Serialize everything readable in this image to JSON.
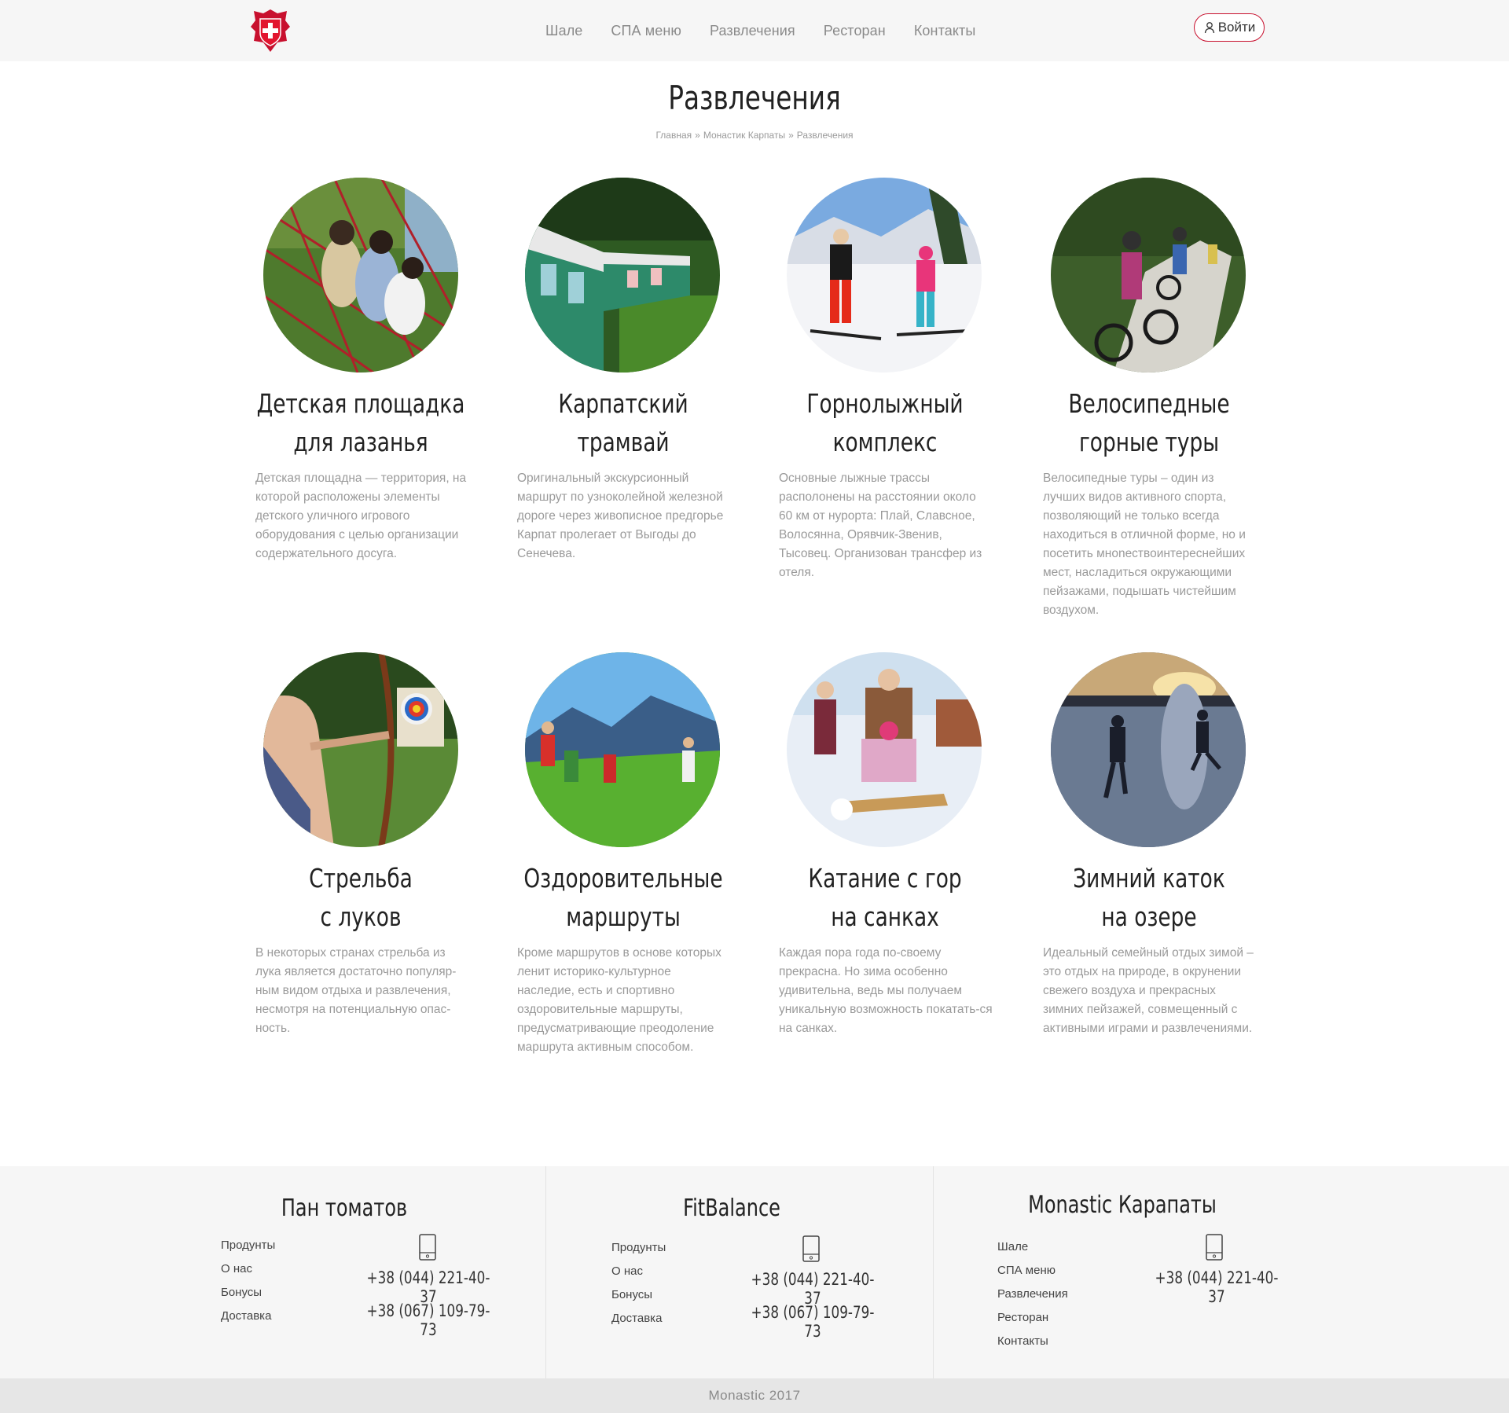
{
  "header": {
    "nav": [
      "Шале",
      "СПА меню",
      "Развлечения",
      "Ресторан",
      "Контакты"
    ],
    "login_label": "Войти"
  },
  "page": {
    "title": "Развлечения",
    "breadcrumb": [
      "Главная",
      "Монастик Карпаты",
      "Развлечения"
    ],
    "breadcrumb_sep": "»"
  },
  "cards": [
    {
      "title1": "Детская площадка",
      "title2": "для лазанья",
      "text": "Детская площадна — территория, на которой расположены элементы детского уличного игрового оборудования с целью организации содержательного досуга.",
      "image": "kids-climbing-net-photo"
    },
    {
      "title1": "Карпатский",
      "title2": "трамвай",
      "text": "Оригинальный экскурсионный маршрут по узноколейной железной дороге через живописное предгорье Карпат пролегает от Выгоды до Сенечева.",
      "image": "mountain-tram-photo"
    },
    {
      "title1": "Горнолыжный",
      "title2": "комплекс",
      "text": "Основные лыжные трассы располонены на расстоянии около 60 км от нурорта: Плай, Славсное, Волосянна, Орявчик-Звенив, Тысовец. Организован трансфер из отеля.",
      "image": "skiers-photo"
    },
    {
      "title1": "Велосипедные",
      "title2": "горные туры",
      "text": "Велосипедные туры – один из лучших видов активного спорта, позволяющий не только всегда находиться в отличной форме, но и посетить мноnествоинтереснейших мест, насладиться окружающими пейзажами, подышать чистейшим воздухом.",
      "image": "mountain-bikers-photo"
    },
    {
      "title1": "Стрельба",
      "title2": "с луков",
      "text": " В некоторых странах стрельба из лука является достаточно популяр-ным видом отдыха и развлечения, несмотря на потенциальную опас-ность.",
      "image": "archery-photo"
    },
    {
      "title1": "Оздоровительные",
      "title2": "маршруты",
      "text": "Кроме маршрутов в основе которых ленит историко-культурное наследие, есть и спортивно оздоровительные маршруты, предусматривающие преодоление маршрута активным способом.",
      "image": "hikers-photo"
    },
    {
      "title1": "Катание с гор",
      "title2": "на санках",
      "text": "Каждая пора года по-своему прекрасна. Но зима особенно удивительна, ведь мы получаем уникальную возможность покатать-ся на санках.",
      "image": "sledding-photo"
    },
    {
      "title1": "Зимний каток",
      "title2": "на озере",
      "text": "Идеальный семейный отдых зимой – это отдых на природе, в окрунении свежего воздуха и прекрасных зимних пейзажей, совмещенный с активными играми и развлечениями.",
      "image": "ice-skating-lake-photo"
    }
  ],
  "footer": [
    {
      "title": "Пан томатов",
      "links": [
        "Продунты",
        "О нас",
        "Бонусы",
        "Доставка"
      ],
      "phones": [
        "+38 (044) 221-40-37",
        "+38 (067) 109-79-73"
      ]
    },
    {
      "title": "FitBalance",
      "links": [
        "Продунты",
        "О нас",
        "Бонусы",
        "Доставка"
      ],
      "phones": [
        "+38 (044) 221-40-37",
        "+38 (067) 109-79-73"
      ]
    },
    {
      "title": "Monastic Карапаты",
      "links": [
        "Шале",
        "СПА меню",
        "Развлечения",
        "Ресторан",
        "Контакты"
      ],
      "phones": [
        "+38 (044) 221-40-37"
      ]
    }
  ],
  "copyright": "Monastic 2017",
  "colors": {
    "accent": "#c8102e",
    "header_bg": "#f6f6f6",
    "footer_bg": "#f6f6f6",
    "copyright_bg": "#e6e6e6"
  }
}
